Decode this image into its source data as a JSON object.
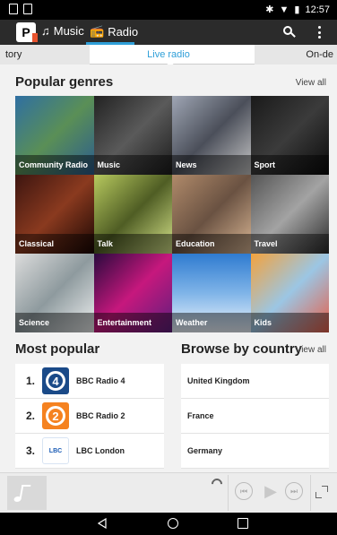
{
  "status_bar": {
    "time": "12:57"
  },
  "app_bar": {
    "logo_letter": "P",
    "tabs": [
      {
        "label": "Music"
      },
      {
        "label": "Radio"
      }
    ]
  },
  "sub_tabs": [
    {
      "label": "tory"
    },
    {
      "label": "Live radio"
    },
    {
      "label": "On-de"
    }
  ],
  "popular_genres": {
    "title": "Popular genres",
    "view_all": "View all",
    "items": [
      {
        "label": "Community Radio"
      },
      {
        "label": "Music"
      },
      {
        "label": "News"
      },
      {
        "label": "Sport"
      },
      {
        "label": "Classical"
      },
      {
        "label": "Talk"
      },
      {
        "label": "Education"
      },
      {
        "label": "Travel"
      },
      {
        "label": "Science"
      },
      {
        "label": "Entertainment"
      },
      {
        "label": "Weather"
      },
      {
        "label": "Kids"
      }
    ]
  },
  "most_popular": {
    "title": "Most popular",
    "items": [
      {
        "rank": "1.",
        "name": "BBC Radio 4",
        "logo_text": "4"
      },
      {
        "rank": "2.",
        "name": "BBC Radio 2",
        "logo_text": "2"
      },
      {
        "rank": "3.",
        "name": "LBC London",
        "logo_text": "LBC"
      }
    ]
  },
  "browse_by_country": {
    "title": "Browse by country",
    "view_all": "View all",
    "items": [
      {
        "name": "United Kingdom"
      },
      {
        "name": "France"
      },
      {
        "name": "Germany"
      }
    ]
  },
  "player": {
    "prev_icon": "⏮",
    "play_icon": "▶",
    "next_icon": "⏭"
  },
  "colors": {
    "accent": "#2f9fd8",
    "app_bar": "#2b2b2b"
  }
}
